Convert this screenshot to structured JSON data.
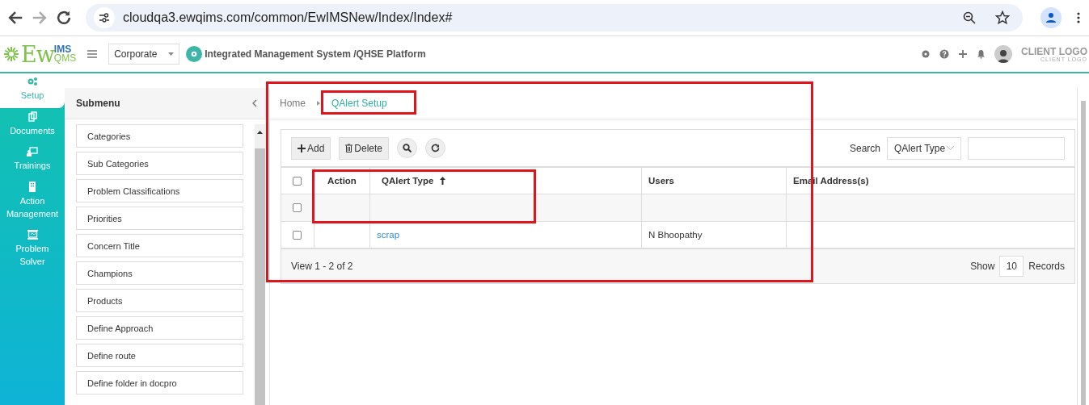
{
  "browser": {
    "url": "cloudqa3.ewqims.com/common/EwIMSNew/Index/Index#"
  },
  "header": {
    "logo": {
      "main": "Ew",
      "top": "IMS",
      "bottom": "QMS"
    },
    "org_select": "Corporate",
    "title": "Integrated Management System /QHSE Platform",
    "client_logo": {
      "main": "CLIENT LOGO",
      "sub": "CLIENT LOGO"
    }
  },
  "nav": [
    {
      "label": "Setup",
      "kind": "gears",
      "selected": true
    },
    {
      "label": "Documents",
      "kind": "copy",
      "selected": false
    },
    {
      "label": "Trainings",
      "kind": "training",
      "selected": false
    },
    {
      "label": "Action Management",
      "kind": "building",
      "selected": false
    },
    {
      "label": "Problem Solver",
      "kind": "board",
      "selected": false
    }
  ],
  "submenu": {
    "title": "Submenu",
    "items": [
      "Categories",
      "Sub Categories",
      "Problem Classifications",
      "Priorities",
      "Concern Title",
      "Champions",
      "Products",
      "Define Approach",
      "Define route",
      "Define folder in docpro"
    ]
  },
  "content": {
    "highlighted": true,
    "breadcrumb": [
      {
        "label": "Home",
        "selected": false,
        "highlighted": false
      },
      {
        "label": "QAlert Setup",
        "selected": true,
        "highlighted": true
      }
    ],
    "toolbar": {
      "add": "Add",
      "delete": "Delete",
      "search_label": "Search",
      "search_by": "QAlert Type"
    },
    "table": {
      "columns": [
        {
          "label": "Action",
          "sorted": false,
          "highlighted": true
        },
        {
          "label": "QAlert Type",
          "sorted": true,
          "highlighted": true
        },
        {
          "label": "Users",
          "sorted": false,
          "highlighted": false
        },
        {
          "label": "Email Address(s)",
          "sorted": false,
          "highlighted": false
        }
      ],
      "header_checked": false,
      "rows": [
        {
          "kind": "filter",
          "checked": false,
          "cells": [
            "",
            "",
            "",
            ""
          ]
        },
        {
          "kind": "data",
          "checked": false,
          "cells": [
            "",
            "scrap",
            "N Bhoopathy",
            ""
          ]
        }
      ]
    },
    "footer": {
      "view": "View 1 - 2 of 2",
      "show_label": "Show",
      "page_size": "10",
      "records_label": "Records"
    }
  }
}
